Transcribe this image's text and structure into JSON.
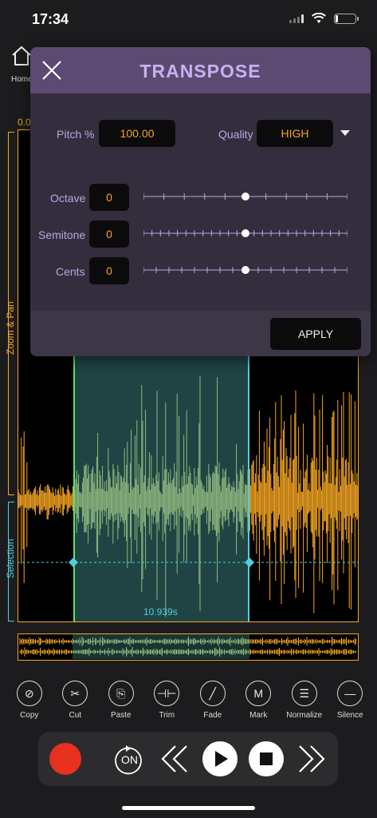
{
  "status_bar": {
    "time": "17:34"
  },
  "header": {
    "home_label": "Home",
    "start_time": "0.0"
  },
  "brackets": {
    "zoom_label": "Zoom & Pan",
    "selection_label": "Selection"
  },
  "selection": {
    "duration": "10.939s"
  },
  "tools": [
    {
      "label": "Copy",
      "icon": "paperclip-icon",
      "glyph": "⊘"
    },
    {
      "label": "Cut",
      "icon": "scissors-icon",
      "glyph": "✂"
    },
    {
      "label": "Paste",
      "icon": "paste-icon",
      "glyph": "⎘"
    },
    {
      "label": "Trim",
      "icon": "trim-icon",
      "glyph": "⊣⊢"
    },
    {
      "label": "Fade",
      "icon": "fade-icon",
      "glyph": "╱"
    },
    {
      "label": "Mark",
      "icon": "mark-icon",
      "glyph": "M"
    },
    {
      "label": "Normalize",
      "icon": "normalize-icon",
      "glyph": "☰"
    },
    {
      "label": "Silence",
      "icon": "silence-icon",
      "glyph": "—"
    }
  ],
  "transport": {
    "loop_label": "ON"
  },
  "dialog": {
    "title": "TRANSPOSE",
    "pitch_label": "Pitch %",
    "pitch_value": "100.00",
    "quality_label": "Quality",
    "quality_value": "HIGH",
    "octave_label": "Octave",
    "octave_value": "0",
    "semitone_label": "Semitone",
    "semitone_value": "0",
    "cents_label": "Cents",
    "cents_value": "0",
    "octave_level": 0.5,
    "semitone_level": 0.5,
    "cents_level": 0.5,
    "apply_label": "APPLY"
  },
  "colors": {
    "waveform": "#f5a623",
    "selection_wave": "#c8d36a",
    "selection_start": "#5fe36d",
    "selection_end": "#4dd0e1",
    "record": "#e8301f",
    "dialog_title": "#c5b3f0"
  }
}
